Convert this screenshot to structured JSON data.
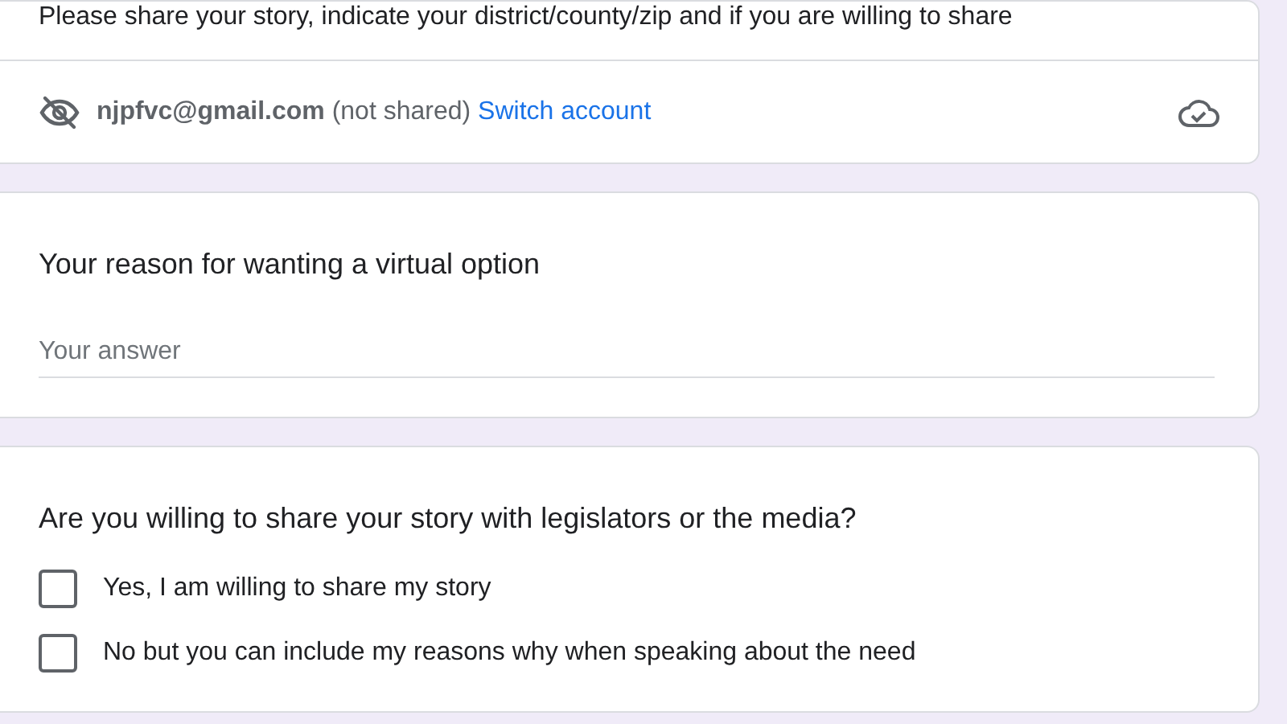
{
  "intro_card": {
    "description": "Please share your story, indicate your district/county/zip and if you are willing to share",
    "account": {
      "email": "njpfvc@gmail.com",
      "status": "(not shared)",
      "switch_link": "Switch account"
    }
  },
  "questions": [
    {
      "kind": "text",
      "title": "Your reason for wanting a virtual option",
      "placeholder": "Your answer"
    },
    {
      "kind": "checkbox",
      "title": "Are you willing to share your story with legislators or the media?",
      "options": [
        {
          "label": "Yes, I am willing to share my story",
          "checked": false
        },
        {
          "label": "No but you can include my reasons why when speaking about the need",
          "checked": false
        }
      ]
    }
  ]
}
